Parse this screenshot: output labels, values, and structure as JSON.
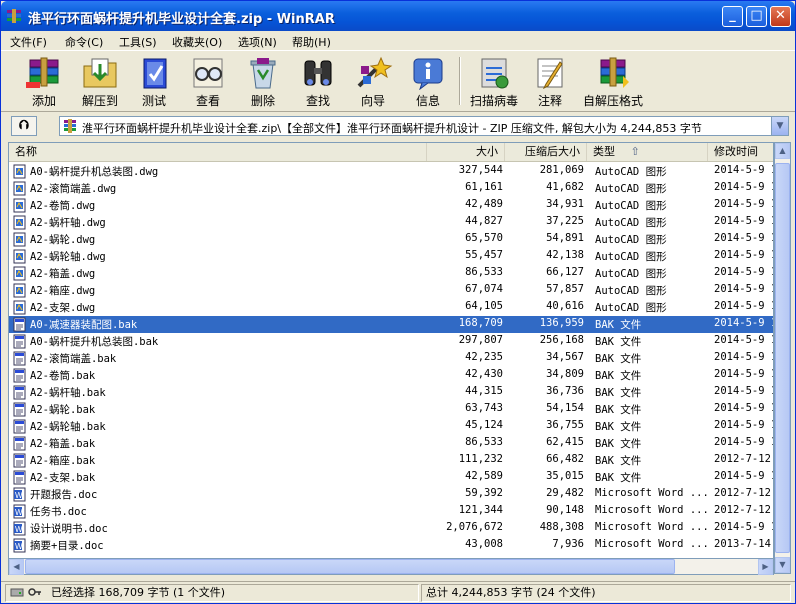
{
  "window": {
    "title": "淮平行环面蜗杆提升机毕业设计全套.zip - WinRAR",
    "minimize": "_",
    "maximize": "□",
    "close": "✕"
  },
  "menu": [
    "文件(F)",
    "命令(C)",
    "工具(S)",
    "收藏夹(O)",
    "选项(N)",
    "帮助(H)"
  ],
  "toolbar": [
    {
      "label": "添加",
      "icon": "add-books-icon"
    },
    {
      "label": "解压到",
      "icon": "extract-folder-icon"
    },
    {
      "label": "测试",
      "icon": "test-book-icon"
    },
    {
      "label": "查看",
      "icon": "view-glasses-icon"
    },
    {
      "label": "删除",
      "icon": "delete-recycle-icon"
    },
    {
      "label": "查找",
      "icon": "find-binoculars-icon"
    },
    {
      "label": "向导",
      "icon": "wizard-icon"
    },
    {
      "label": "信息",
      "icon": "info-icon"
    },
    {
      "label": "扫描病毒",
      "icon": "virus-scan-icon"
    },
    {
      "label": "注释",
      "icon": "comment-icon"
    },
    {
      "label": "自解压格式",
      "icon": "sfx-icon"
    }
  ],
  "path": {
    "up_label": "⮉",
    "text": "淮平行环面蜗杆提升机毕业设计全套.zip\\【全部文件】淮平行环面蜗杆提升机设计 - ZIP 压缩文件, 解包大小为 4,244,853 字节"
  },
  "columns": {
    "name": "名称",
    "size": "大小",
    "packed": "压缩后大小",
    "type": "类型",
    "sort_arrow": "⇧",
    "modified": "修改时间"
  },
  "files": [
    {
      "name": "A0-蜗杆提升机总装图.dwg",
      "size": "327,544",
      "packed": "281,069",
      "type": "AutoCAD 图形",
      "date": "2014-5-9 1",
      "kind": "dwg"
    },
    {
      "name": "A2-滚筒端盖.dwg",
      "size": "61,161",
      "packed": "41,682",
      "type": "AutoCAD 图形",
      "date": "2014-5-9 1",
      "kind": "dwg"
    },
    {
      "name": "A2-卷筒.dwg",
      "size": "42,489",
      "packed": "34,931",
      "type": "AutoCAD 图形",
      "date": "2014-5-9 1",
      "kind": "dwg"
    },
    {
      "name": "A2-蜗杆轴.dwg",
      "size": "44,827",
      "packed": "37,225",
      "type": "AutoCAD 图形",
      "date": "2014-5-9 1",
      "kind": "dwg"
    },
    {
      "name": "A2-蜗轮.dwg",
      "size": "65,570",
      "packed": "54,891",
      "type": "AutoCAD 图形",
      "date": "2014-5-9 1",
      "kind": "dwg"
    },
    {
      "name": "A2-蜗轮轴.dwg",
      "size": "55,457",
      "packed": "42,138",
      "type": "AutoCAD 图形",
      "date": "2014-5-9 1",
      "kind": "dwg"
    },
    {
      "name": "A2-箱盖.dwg",
      "size": "86,533",
      "packed": "66,127",
      "type": "AutoCAD 图形",
      "date": "2014-5-9 1",
      "kind": "dwg"
    },
    {
      "name": "A2-箱座.dwg",
      "size": "67,074",
      "packed": "57,857",
      "type": "AutoCAD 图形",
      "date": "2014-5-9 1",
      "kind": "dwg"
    },
    {
      "name": "A2-支架.dwg",
      "size": "64,105",
      "packed": "40,616",
      "type": "AutoCAD 图形",
      "date": "2014-5-9 1",
      "kind": "dwg"
    },
    {
      "name": "A0-减速器装配图.bak",
      "size": "168,709",
      "packed": "136,959",
      "type": "BAK 文件",
      "date": "2014-5-9 1",
      "kind": "bak",
      "selected": true
    },
    {
      "name": "A0-蜗杆提升机总装图.bak",
      "size": "297,807",
      "packed": "256,168",
      "type": "BAK 文件",
      "date": "2014-5-9 1",
      "kind": "bak"
    },
    {
      "name": "A2-滚筒端盖.bak",
      "size": "42,235",
      "packed": "34,567",
      "type": "BAK 文件",
      "date": "2014-5-9 1",
      "kind": "bak"
    },
    {
      "name": "A2-卷筒.bak",
      "size": "42,430",
      "packed": "34,809",
      "type": "BAK 文件",
      "date": "2014-5-9 1",
      "kind": "bak"
    },
    {
      "name": "A2-蜗杆轴.bak",
      "size": "44,315",
      "packed": "36,736",
      "type": "BAK 文件",
      "date": "2014-5-9 1",
      "kind": "bak"
    },
    {
      "name": "A2-蜗轮.bak",
      "size": "63,743",
      "packed": "54,154",
      "type": "BAK 文件",
      "date": "2014-5-9 1",
      "kind": "bak"
    },
    {
      "name": "A2-蜗轮轴.bak",
      "size": "45,124",
      "packed": "36,755",
      "type": "BAK 文件",
      "date": "2014-5-9 1",
      "kind": "bak"
    },
    {
      "name": "A2-箱盖.bak",
      "size": "86,533",
      "packed": "62,415",
      "type": "BAK 文件",
      "date": "2014-5-9 1",
      "kind": "bak"
    },
    {
      "name": "A2-箱座.bak",
      "size": "111,232",
      "packed": "66,482",
      "type": "BAK 文件",
      "date": "2012-7-12",
      "kind": "bak"
    },
    {
      "name": "A2-支架.bak",
      "size": "42,589",
      "packed": "35,015",
      "type": "BAK 文件",
      "date": "2014-5-9 1",
      "kind": "bak"
    },
    {
      "name": "开题报告.doc",
      "size": "59,392",
      "packed": "29,482",
      "type": "Microsoft Word ...",
      "date": "2012-7-12",
      "kind": "doc"
    },
    {
      "name": "任务书.doc",
      "size": "121,344",
      "packed": "90,148",
      "type": "Microsoft Word ...",
      "date": "2012-7-12",
      "kind": "doc"
    },
    {
      "name": "设计说明书.doc",
      "size": "2,076,672",
      "packed": "488,308",
      "type": "Microsoft Word ...",
      "date": "2014-5-9 1",
      "kind": "doc"
    },
    {
      "name": "摘要+目录.doc",
      "size": "43,008",
      "packed": "7,936",
      "type": "Microsoft Word ...",
      "date": "2013-7-14",
      "kind": "doc"
    }
  ],
  "status": {
    "selected": "已经选择 168,709 字节 (1 个文件)",
    "total": "总计 4,244,853 字节 (24 个文件)"
  },
  "colors": {
    "title_gradient": "#0a5fdc",
    "selection": "#316ac5",
    "chrome": "#ece9d8"
  }
}
